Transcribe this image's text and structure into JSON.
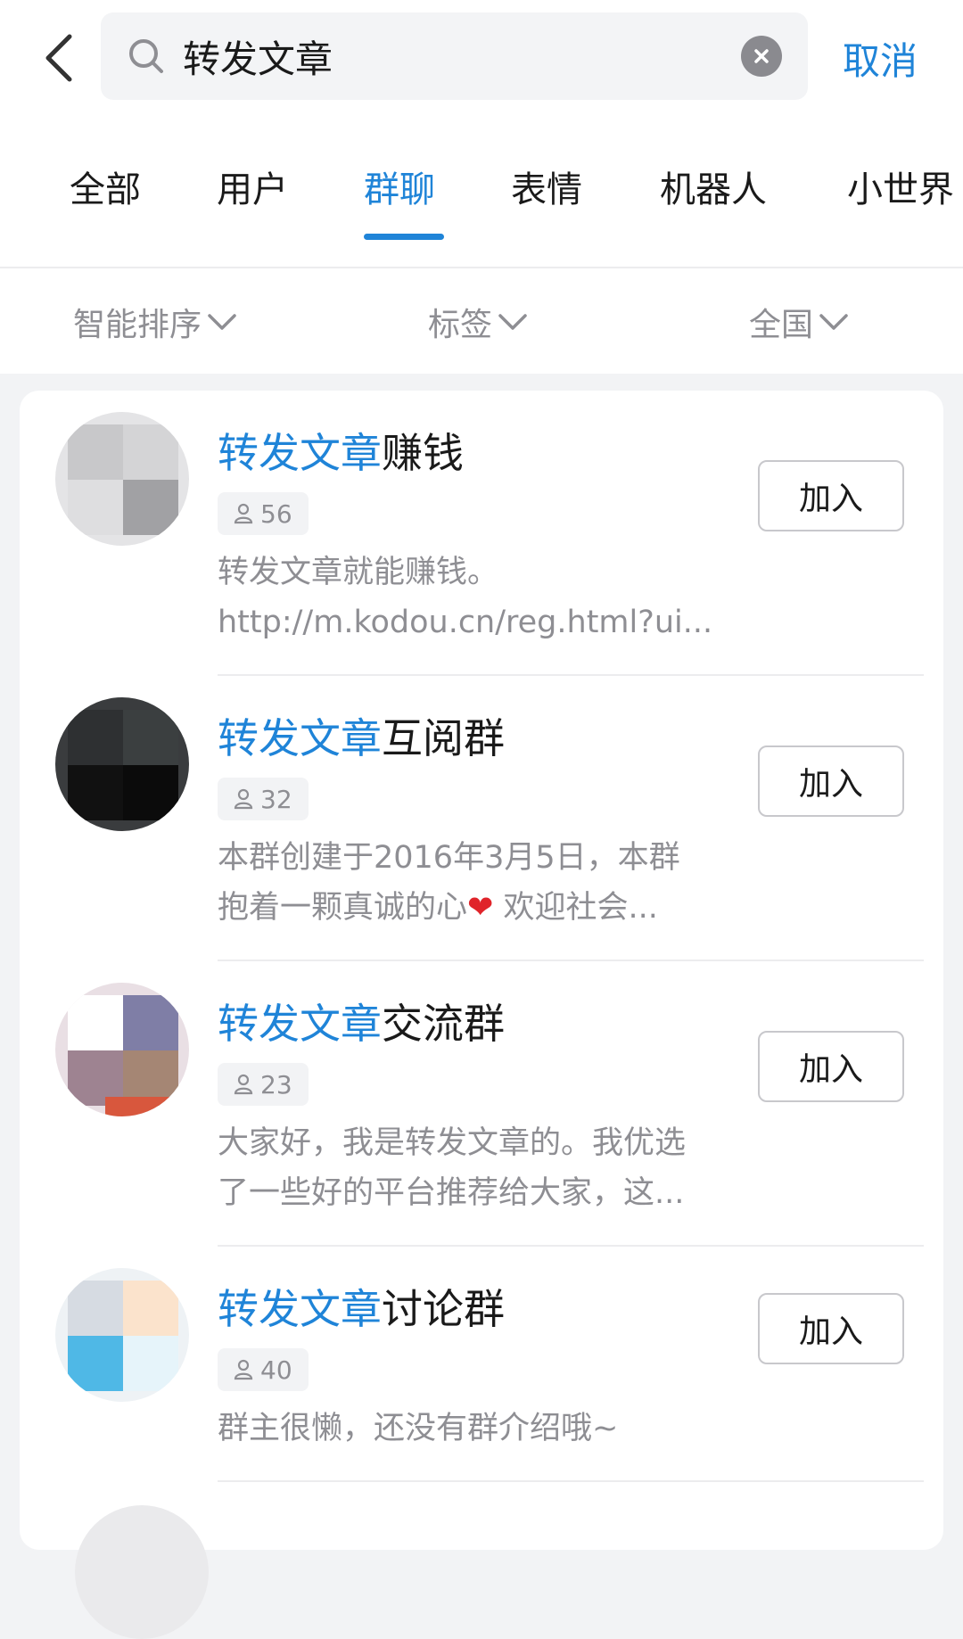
{
  "search": {
    "query": "转发文章",
    "cancel_label": "取消"
  },
  "tabs": [
    {
      "label": "全部"
    },
    {
      "label": "用户"
    },
    {
      "label": "群聊",
      "active": true
    },
    {
      "label": "表情"
    },
    {
      "label": "机器人"
    },
    {
      "label": "小世界"
    }
  ],
  "filters": [
    {
      "label": "智能排序"
    },
    {
      "label": "标签"
    },
    {
      "label": "全国"
    }
  ],
  "groups": [
    {
      "title_highlight": "转发文章",
      "title_rest": "赚钱",
      "members": "56",
      "desc_line1": "转发文章就能赚钱。",
      "desc_line2": "http://m.kodou.cn/reg.html?ui...",
      "join_label": "加入"
    },
    {
      "title_highlight": "转发文章",
      "title_rest": "互阅群",
      "members": "32",
      "desc_line1": "本群创建于2016年3月5日，本群",
      "desc_line2_pre": "抱着一颗真诚的心",
      "desc_line2_emoji": "❤",
      "desc_line2_post": " 欢迎社会...",
      "join_label": "加入"
    },
    {
      "title_highlight": "转发文章",
      "title_rest": "交流群",
      "members": "23",
      "desc_line1": "大家好，我是转发文章的。我优选",
      "desc_line2": "了一些好的平台推荐给大家，这...",
      "join_label": "加入"
    },
    {
      "title_highlight": "转发文章",
      "title_rest": "讨论群",
      "members": "40",
      "desc_line1": "群主很懒，还没有群介绍哦~",
      "join_label": "加入"
    }
  ],
  "icons": {
    "back": "chevron-left-icon",
    "search": "search-icon",
    "clear": "clear-icon",
    "dropdown": "chevron-down-icon",
    "member": "person-icon"
  },
  "colors": {
    "accent": "#1f84d8",
    "muted": "#8e8e93",
    "background": "#f2f3f5"
  }
}
